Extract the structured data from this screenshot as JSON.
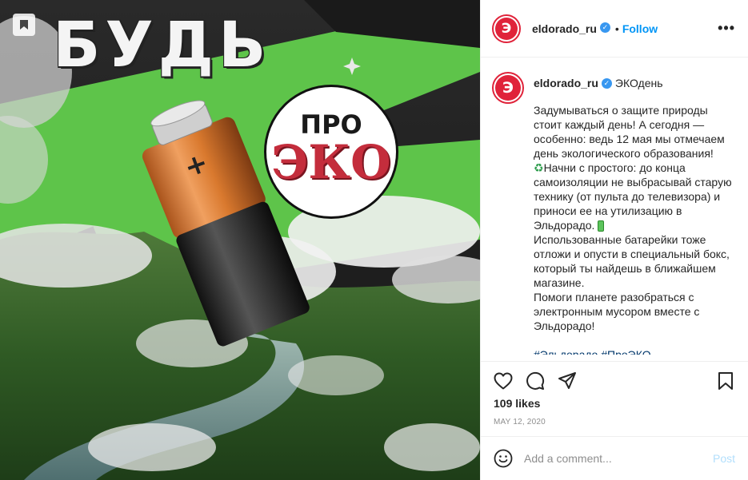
{
  "media": {
    "headline": "БУДЬ",
    "badge_top": "ПРО",
    "badge_main": "ЭКО",
    "battery_symbol": "+",
    "save_icon": "bookmark-icon",
    "colors": {
      "green": "#5ec44a",
      "badge_red": "#c42d3c",
      "battery_orange": "#d9792e"
    }
  },
  "header": {
    "avatar_letter": "Э",
    "username": "eldorado_ru",
    "verified_icon": "verified-badge-icon",
    "dot": "•",
    "follow_label": "Follow",
    "more_label": "•••"
  },
  "caption": {
    "avatar_letter": "Э",
    "username": "eldorado_ru",
    "title": "ЭКОдень",
    "p1": "Задумываться о защите природы стоит каждый день! А сегодня — особенно: ведь 12 мая мы отмечаем день экологического образования!",
    "recycle_emoji": "♻",
    "p2": "Начни с простого: до конца самоизоляции не выбрасывай старую технику (от пульта до телевизора) и приноси ее на утилизацию в Эльдорадо.",
    "p3": "Использованные батарейки тоже отложи и опусти в специальный бокс, который ты найдешь в ближайшем магазине.",
    "p4": "Помоги планете разобраться с электронным мусором вместе с Эльдорадо!",
    "hashtags": "#Эльдорадо #ПроЭКО"
  },
  "actions": {
    "like_icon": "heart-icon",
    "comment_icon": "comment-icon",
    "share_icon": "share-icon",
    "save_icon": "bookmark-icon"
  },
  "likes": "109 likes",
  "date": "MAY 12, 2020",
  "comment": {
    "emoji_icon": "smiley-icon",
    "placeholder": "Add a comment...",
    "post_label": "Post"
  }
}
